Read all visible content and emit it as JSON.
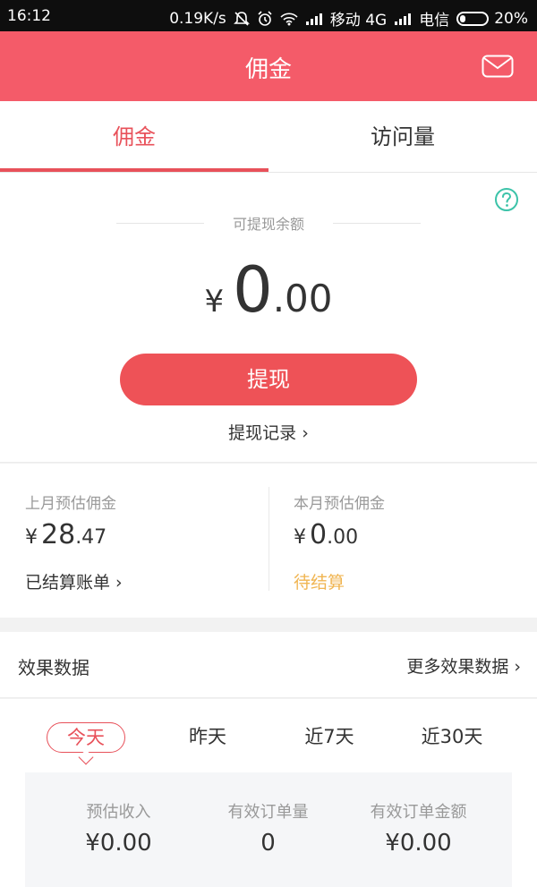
{
  "status_bar": {
    "time": "16:12",
    "net_speed": "0.19K/s",
    "carrier_1": "移动 4G",
    "carrier_2": "电信",
    "battery": "20%"
  },
  "app_bar": {
    "title": "佣金",
    "right_icon": "mail-icon"
  },
  "tabs": [
    {
      "label": "佣金",
      "active": true
    },
    {
      "label": "访问量",
      "active": false
    }
  ],
  "balance": {
    "label": "可提现余额",
    "currency": "¥",
    "amount_int": "0",
    "amount_dec": ".00",
    "withdraw_button": "提现",
    "withdraw_log": "提现记录 ›"
  },
  "estimates": {
    "last_month": {
      "label": "上月预估佣金",
      "currency": "¥",
      "amount_int": "28",
      "amount_dec": ".47",
      "footer": "已结算账单 ›"
    },
    "this_month": {
      "label": "本月预估佣金",
      "currency": "¥",
      "amount_int": "0",
      "amount_dec": ".00",
      "footer": "待结算"
    }
  },
  "performance": {
    "title": "效果数据",
    "more": "更多效果数据 ›",
    "periods": [
      "今天",
      "昨天",
      "近7天",
      "近30天"
    ],
    "active_period": "今天",
    "metrics": [
      {
        "label": "预估收入",
        "value": "¥0.00"
      },
      {
        "label": "有效订单量",
        "value": "0"
      },
      {
        "label": "有效订单金额",
        "value": "¥0.00"
      }
    ]
  },
  "colors": {
    "header": "#f45b69",
    "accent": "#e8515a",
    "button": "#ee5257",
    "pending": "#f0b552",
    "help_icon": "#3cc3a9"
  }
}
